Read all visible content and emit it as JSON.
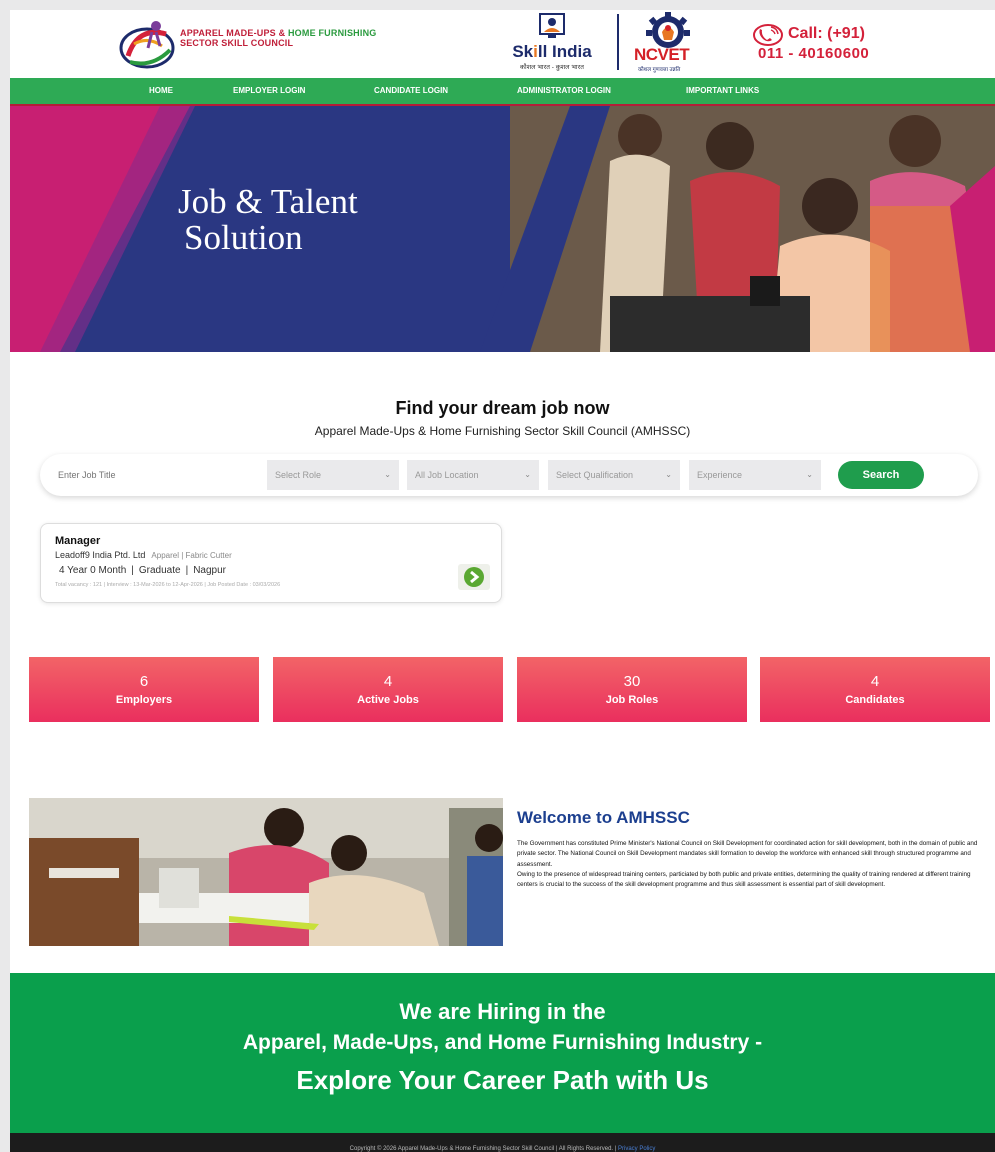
{
  "header": {
    "org_line1_red": "APPAREL MADE-UPS & ",
    "org_line1_green": "HOME FURNISHING",
    "org_line2": "SECTOR SKILL COUNCIL",
    "skill_india_pre": "Sk",
    "skill_india_i": "i",
    "skill_india_post": "ll India",
    "skill_india_tagline": "कौशल भारत - कुशल भारत",
    "ncvet_name": "NCVET",
    "ncvet_tagline": "कौशल गुणवत्ता उन्नति",
    "call_label": "Call: (+91)",
    "call_number": "011 - 40160600",
    "colors": {
      "brand_red": "#d4213a",
      "brand_navy": "#1d2b6b",
      "nav_green": "#2eaa55"
    }
  },
  "nav": {
    "items": [
      {
        "label": "HOME"
      },
      {
        "label": "EMPLOYER LOGIN"
      },
      {
        "label": "CANDIDATE LOGIN"
      },
      {
        "label": "ADMINISTRATOR LOGIN"
      },
      {
        "label": "IMPORTANT LINKS"
      }
    ]
  },
  "hero": {
    "title_line1": "Job & Talent",
    "title_line2": "Solution"
  },
  "search": {
    "title": "Find your dream job now",
    "subtitle": "Apparel Made-Ups & Home Furnishing Sector Skill Council (AMHSSC)",
    "job_title_placeholder": "Enter Job Title",
    "role": "Select Role",
    "location": "All Job Location",
    "qualification": "Select Qualification",
    "experience": "Experience",
    "button": "Search"
  },
  "job": {
    "title": "Manager",
    "company": "Leadoff9 India Ptd. Ltd",
    "role": "Apparel | Fabric Cutter",
    "experience": "4 Year 0 Month",
    "qualification": "Graduate",
    "location": "Nagpur",
    "details": "Total vacancy : 121 | Interview : 13-Mar-2026 to 12-Apr-2026 | Job Posted Date : 03/03/2026"
  },
  "stats": [
    {
      "number": "6",
      "label": "Employers"
    },
    {
      "number": "4",
      "label": "Active Jobs"
    },
    {
      "number": "30",
      "label": "Job Roles"
    },
    {
      "number": "4",
      "label": "Candidates"
    }
  ],
  "welcome": {
    "title": "Welcome to AMHSSC",
    "text": "The Government has constituted Prime Minister's National Council on Skill Development for coordinated action for skill development, both in the domain of public and private sector. The National Council on Skill Development mandates skill formation to develop the workforce with enhanced skill through structured programme and assessment.",
    "text2": "Owing to the presence of widespread training centers, particiated by both public and private entities, determining the quality of training rendered at different training centers is crucial to the success of the skill development programme and thus skill assessment is essential part of skill development."
  },
  "hiring": {
    "line1": "We are Hiring in the",
    "line2": "Apparel, Made-Ups, and Home Furnishing Industry -",
    "line3": "Explore Your Career Path with Us"
  },
  "footer": {
    "copyright": "Copyright © 2026 Apparel Made-Ups & Home Furnishing Sector Skill Council | All Rights Reserved. | ",
    "privacy": "Privacy Policy"
  }
}
